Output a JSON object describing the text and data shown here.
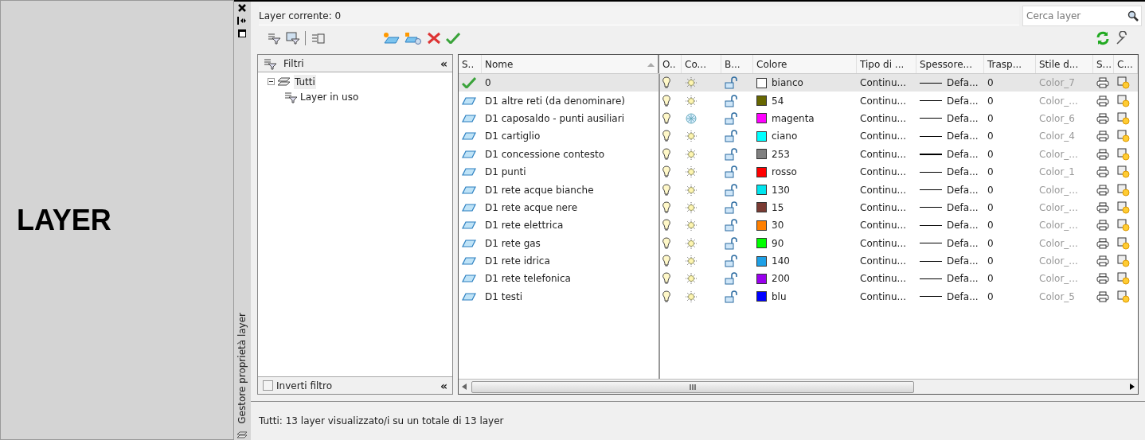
{
  "side_label": "LAYER",
  "palette": {
    "title": "Gestore proprietà layer"
  },
  "current_layer": "Layer corrente: 0",
  "search": {
    "placeholder": "Cerca layer"
  },
  "filters": {
    "title": "Filtri",
    "collapse": "«",
    "tree": [
      {
        "label": "Tutti",
        "expanded": true,
        "children": [
          {
            "label": "Layer in uso"
          }
        ]
      }
    ],
    "invert": {
      "label": "Inverti filtro",
      "checked": false
    },
    "invert_collapse": "«"
  },
  "table": {
    "columns": [
      "S..",
      "Nome",
      "O..",
      "Co...",
      "B...",
      "Colore",
      "Tipo di ...",
      "Spessore...",
      "Trasp...",
      "Stile d...",
      "S...",
      "C..."
    ],
    "rows": [
      {
        "current": true,
        "selected": true,
        "name": "0",
        "on": true,
        "frozen": false,
        "locked": false,
        "color": "#ffffff",
        "color_name": "bianco",
        "linetype": "Continu...",
        "heavy": false,
        "lineweight": "Defa...",
        "transparency": "0",
        "plot_style": "Color_7"
      },
      {
        "current": false,
        "selected": false,
        "name": "D1 altre reti (da denominare)",
        "on": true,
        "frozen": false,
        "locked": false,
        "color": "#666600",
        "color_name": "54",
        "linetype": "Continu...",
        "heavy": false,
        "lineweight": "Defa...",
        "transparency": "0",
        "plot_style": "Color_..."
      },
      {
        "current": false,
        "selected": false,
        "name": "D1 caposaldo - punti ausiliari",
        "on": true,
        "frozen": true,
        "locked": false,
        "color": "#ff00ff",
        "color_name": "magenta",
        "linetype": "Continu...",
        "heavy": false,
        "lineweight": "Defa...",
        "transparency": "0",
        "plot_style": "Color_6"
      },
      {
        "current": false,
        "selected": false,
        "name": "D1 cartiglio",
        "on": true,
        "frozen": false,
        "locked": false,
        "color": "#00ffff",
        "color_name": "ciano",
        "linetype": "Continu...",
        "heavy": false,
        "lineweight": "Defa...",
        "transparency": "0",
        "plot_style": "Color_4"
      },
      {
        "current": false,
        "selected": false,
        "name": "D1 concessione contesto",
        "on": true,
        "frozen": false,
        "locked": false,
        "color": "#808080",
        "color_name": "253",
        "linetype": "Continu...",
        "heavy": true,
        "lineweight": "Defa...",
        "transparency": "0",
        "plot_style": "Color_..."
      },
      {
        "current": false,
        "selected": false,
        "name": "D1 punti",
        "on": true,
        "frozen": false,
        "locked": false,
        "color": "#ff0000",
        "color_name": "rosso",
        "linetype": "Continu...",
        "heavy": false,
        "lineweight": "Defa...",
        "transparency": "0",
        "plot_style": "Color_1"
      },
      {
        "current": false,
        "selected": false,
        "name": "D1 rete acque bianche",
        "on": true,
        "frozen": false,
        "locked": false,
        "color": "#00e5ee",
        "color_name": "130",
        "linetype": "Continu...",
        "heavy": false,
        "lineweight": "Defa...",
        "transparency": "0",
        "plot_style": "Color_..."
      },
      {
        "current": false,
        "selected": false,
        "name": "D1 rete acque nere",
        "on": true,
        "frozen": false,
        "locked": false,
        "color": "#7a3b33",
        "color_name": "15",
        "linetype": "Continu...",
        "heavy": false,
        "lineweight": "Defa...",
        "transparency": "0",
        "plot_style": "Color_..."
      },
      {
        "current": false,
        "selected": false,
        "name": "D1 rete elettrica",
        "on": true,
        "frozen": false,
        "locked": false,
        "color": "#ff7f00",
        "color_name": "30",
        "linetype": "Continu...",
        "heavy": false,
        "lineweight": "Defa...",
        "transparency": "0",
        "plot_style": "Color_..."
      },
      {
        "current": false,
        "selected": false,
        "name": "D1 rete gas",
        "on": true,
        "frozen": false,
        "locked": false,
        "color": "#00ff00",
        "color_name": "90",
        "linetype": "Continu...",
        "heavy": false,
        "lineweight": "Defa...",
        "transparency": "0",
        "plot_style": "Color_..."
      },
      {
        "current": false,
        "selected": false,
        "name": "D1 rete idrica",
        "on": true,
        "frozen": false,
        "locked": false,
        "color": "#1ea0e6",
        "color_name": "140",
        "linetype": "Continu...",
        "heavy": false,
        "lineweight": "Defa...",
        "transparency": "0",
        "plot_style": "Color_..."
      },
      {
        "current": false,
        "selected": false,
        "name": "D1 rete telefonica",
        "on": true,
        "frozen": false,
        "locked": false,
        "color": "#9900ee",
        "color_name": "200",
        "linetype": "Continu...",
        "heavy": false,
        "lineweight": "Defa...",
        "transparency": "0",
        "plot_style": "Color_..."
      },
      {
        "current": false,
        "selected": false,
        "name": "D1 testi",
        "on": true,
        "frozen": false,
        "locked": false,
        "color": "#0000ff",
        "color_name": "blu",
        "linetype": "Continu...",
        "heavy": false,
        "lineweight": "Defa...",
        "transparency": "0",
        "plot_style": "Color_5"
      }
    ]
  },
  "status_bar": "Tutti: 13 layer visualizzato/i su un totale di 13 layer"
}
